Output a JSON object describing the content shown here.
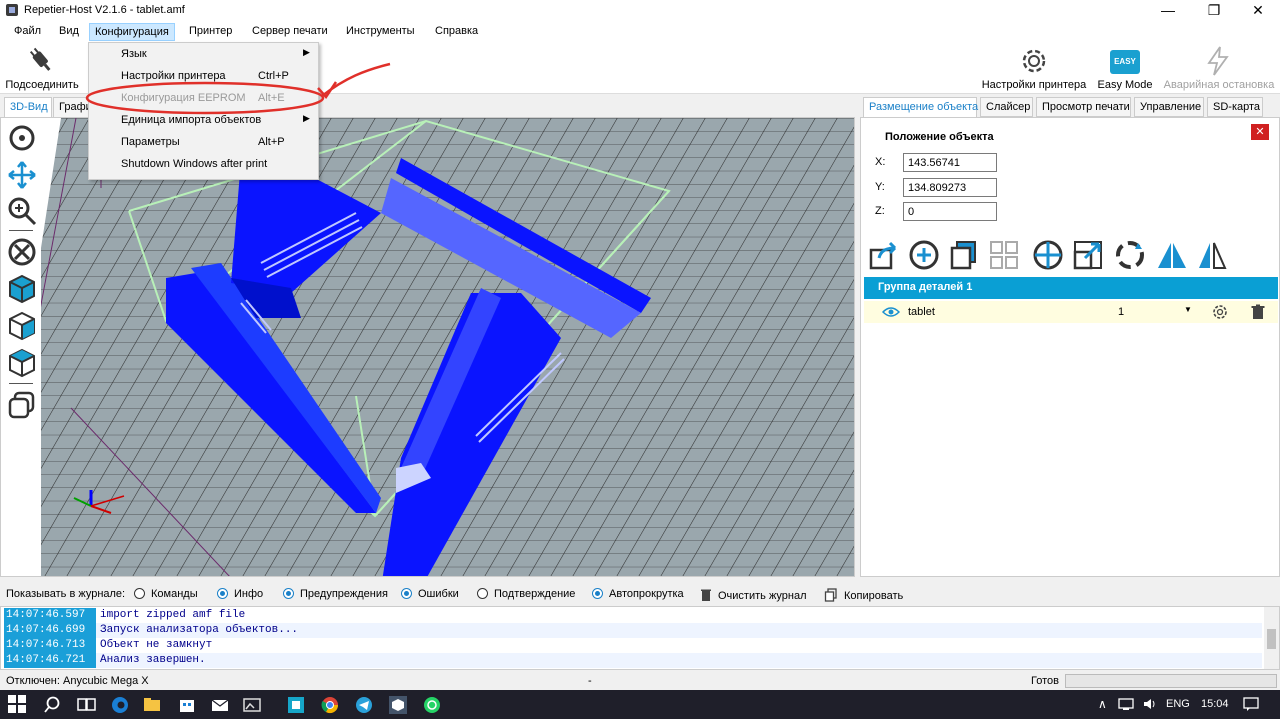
{
  "window": {
    "title": "Repetier-Host V2.1.6 - tablet.amf",
    "minimize": "—",
    "maximize": "❐",
    "close": "✕"
  },
  "menubar": {
    "items": [
      "Файл",
      "Вид",
      "Конфигурация",
      "Принтер",
      "Сервер печати",
      "Инструменты",
      "Справка"
    ],
    "active": "Конфигурация"
  },
  "dropdown": {
    "items": [
      {
        "label": "Язык",
        "shortcut": "",
        "submenu": true,
        "disabled": false
      },
      {
        "label": "Настройки принтера",
        "shortcut": "Ctrl+P",
        "submenu": false,
        "disabled": false
      },
      {
        "label": "Конфигурация EEPROM",
        "shortcut": "Alt+E",
        "submenu": false,
        "disabled": true
      },
      {
        "label": "Единица импорта объектов",
        "shortcut": "",
        "submenu": true,
        "disabled": false
      },
      {
        "label": "Параметры",
        "shortcut": "Alt+P",
        "submenu": false,
        "disabled": false
      },
      {
        "label": "Shutdown Windows after print",
        "shortcut": "",
        "submenu": false,
        "disabled": false
      }
    ],
    "submenu_arrow": "▶"
  },
  "toolbar": {
    "connect": "Подсоединить",
    "printer_settings": "Настройки принтера",
    "easy_mode": "Easy Mode",
    "easy_badge": "EASY",
    "emergency_stop": "Аварийная остановка"
  },
  "left_tabs": [
    "3D-Вид",
    "Графи"
  ],
  "right_tabs": [
    "Размещение объекта",
    "Слайсер",
    "Просмотр печати",
    "Управление",
    "SD-карта"
  ],
  "object_position": {
    "title": "Положение объекта",
    "x_label": "X:",
    "x": "143.56741",
    "y_label": "Y:",
    "y": "134.809273",
    "z_label": "Z:",
    "z": "0",
    "close": "✕"
  },
  "group": {
    "header": "Группа деталей 1",
    "object_name": "tablet",
    "copies": "1"
  },
  "log": {
    "show_label": "Показывать в журнале:",
    "options": [
      {
        "label": "Команды",
        "on": false
      },
      {
        "label": "Инфо",
        "on": true
      },
      {
        "label": "Предупреждения",
        "on": true
      },
      {
        "label": "Ошибки",
        "on": true
      },
      {
        "label": "Подтверждение",
        "on": false
      },
      {
        "label": "Автопрокрутка",
        "on": true
      }
    ],
    "clear": "Очистить журнал",
    "copy": "Копировать",
    "entries": [
      {
        "time": "14:07:46.597",
        "text": "import zipped amf file"
      },
      {
        "time": "14:07:46.699",
        "text": "Запуск анализатора объектов..."
      },
      {
        "time": "14:07:46.713",
        "text": "Объект не замкнут"
      },
      {
        "time": "14:07:46.721",
        "text": "Анализ завершен."
      }
    ]
  },
  "status": {
    "left": "Отключен: Anycubic Mega X",
    "mid": "-",
    "right": "Готов"
  },
  "taskbar": {
    "lang": "ENG",
    "time": "15:04",
    "chevron": "∧"
  },
  "colors": {
    "accent": "#1a80c8",
    "model": "#0a14ff",
    "bed": "#9aa7ad",
    "annotation": "#e0302a",
    "group_header": "#0a9fd4"
  }
}
